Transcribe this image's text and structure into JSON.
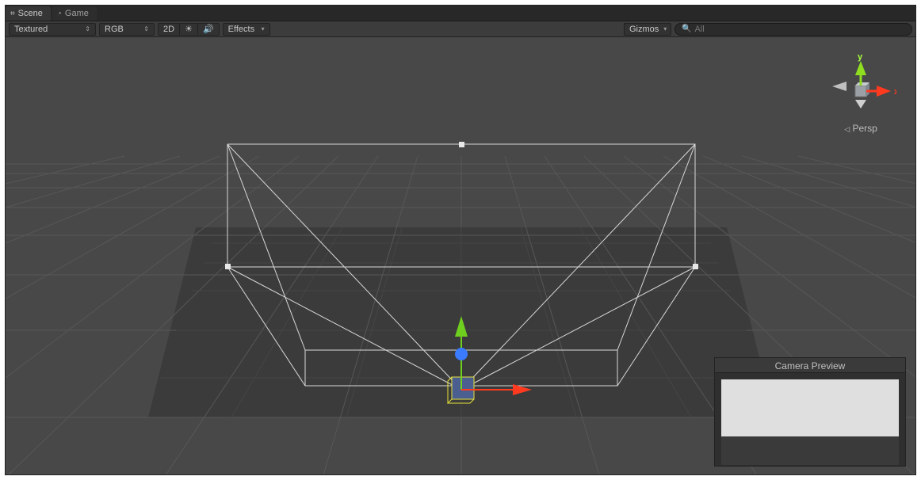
{
  "tabs": {
    "scene": "Scene",
    "game": "Game"
  },
  "toolbar": {
    "shading": "Textured",
    "render": "RGB",
    "twoD": "2D",
    "effects": "Effects",
    "gizmos": "Gizmos",
    "searchPlaceholder": "All"
  },
  "orient": {
    "x": "x",
    "y": "y",
    "mode": "Persp"
  },
  "preview": {
    "title": "Camera Preview"
  },
  "colors": {
    "x": "#ff3a1f",
    "y": "#8fde1f",
    "z": "#3a7bff",
    "grid": "#5a5a5a",
    "darkGrid": "#3f3f3f"
  }
}
